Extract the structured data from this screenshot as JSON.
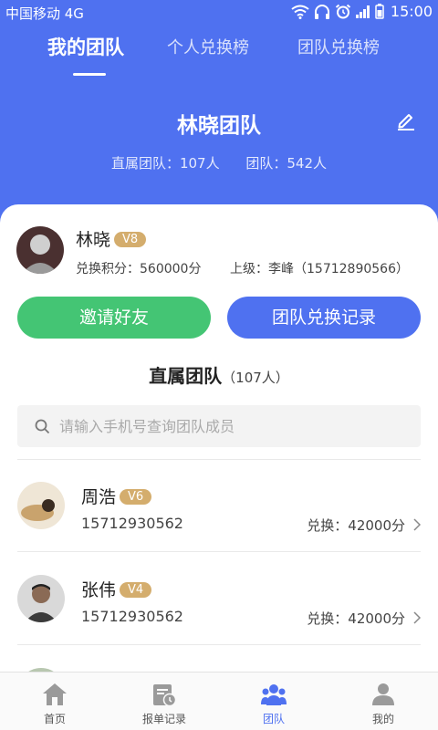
{
  "status_bar": {
    "carrier": "中国移动 4G",
    "time": "15:00"
  },
  "tabs": [
    {
      "label": "我的团队"
    },
    {
      "label": "个人兑换榜"
    },
    {
      "label": "团队兑换榜"
    }
  ],
  "team": {
    "name": "林晓团队",
    "direct_label": "直属团队：107人",
    "total_label": "团队：542人"
  },
  "me": {
    "name": "林晓",
    "level": "V8",
    "points": "兑换积分：560000分",
    "superior": "上级：李峰（15712890566）"
  },
  "actions": {
    "invite": "邀请好友",
    "records": "团队兑换记录"
  },
  "section": {
    "title": "直属团队",
    "count": "（107人）"
  },
  "search": {
    "placeholder": "请输入手机号查询团队成员",
    "value": ""
  },
  "members": [
    {
      "name": "周浩",
      "level": "V6",
      "phone": "15712930562",
      "exchange": "兑换：42000分"
    },
    {
      "name": "张伟",
      "level": "V4",
      "phone": "15712930562",
      "exchange": "兑换：42000分"
    }
  ],
  "bottom_nav": [
    {
      "label": "首页",
      "icon": "home-icon"
    },
    {
      "label": "报单记录",
      "icon": "record-icon"
    },
    {
      "label": "团队",
      "icon": "team-icon"
    },
    {
      "label": "我的",
      "icon": "user-icon"
    }
  ],
  "colors": {
    "primary": "#4f71f0",
    "invite": "#44c574",
    "badge": "#d4ad6d"
  }
}
